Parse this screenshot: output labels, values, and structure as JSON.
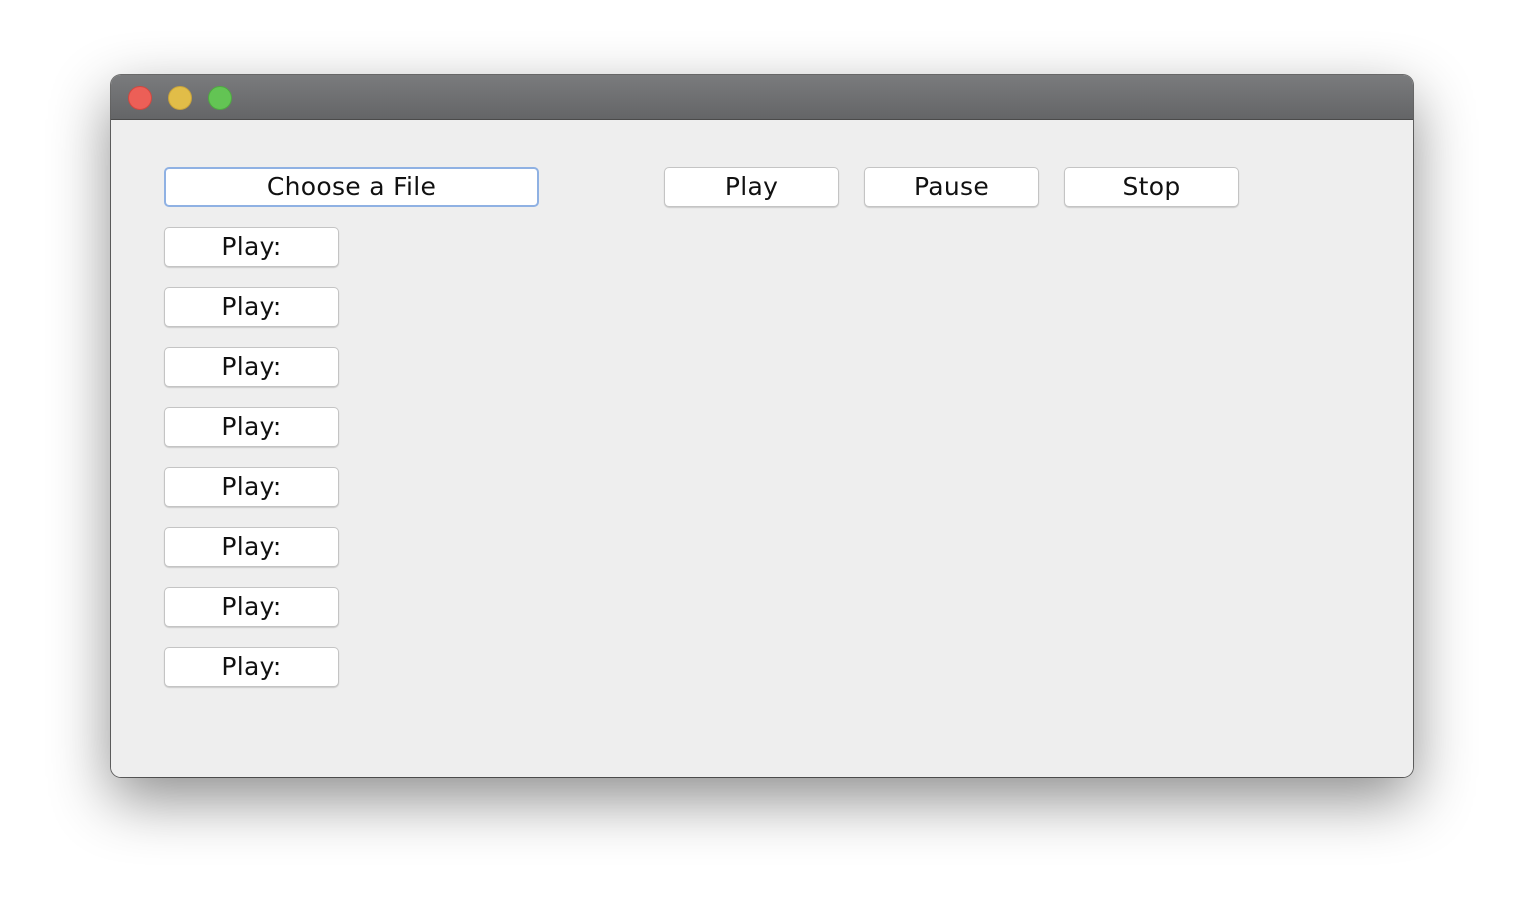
{
  "window": {
    "title": ""
  },
  "controls": {
    "choose_file_label": "Choose a File",
    "play_label": "Play",
    "pause_label": "Pause",
    "stop_label": "Stop"
  },
  "tracks": [
    {
      "label": "Play:"
    },
    {
      "label": "Play:"
    },
    {
      "label": "Play:"
    },
    {
      "label": "Play:"
    },
    {
      "label": "Play:"
    },
    {
      "label": "Play:"
    },
    {
      "label": "Play:"
    },
    {
      "label": "Play:"
    }
  ],
  "colors": {
    "close": "#ec5f57",
    "minimize": "#e1bd48",
    "zoom": "#63c454",
    "focus_ring": "#8fb1e3"
  }
}
